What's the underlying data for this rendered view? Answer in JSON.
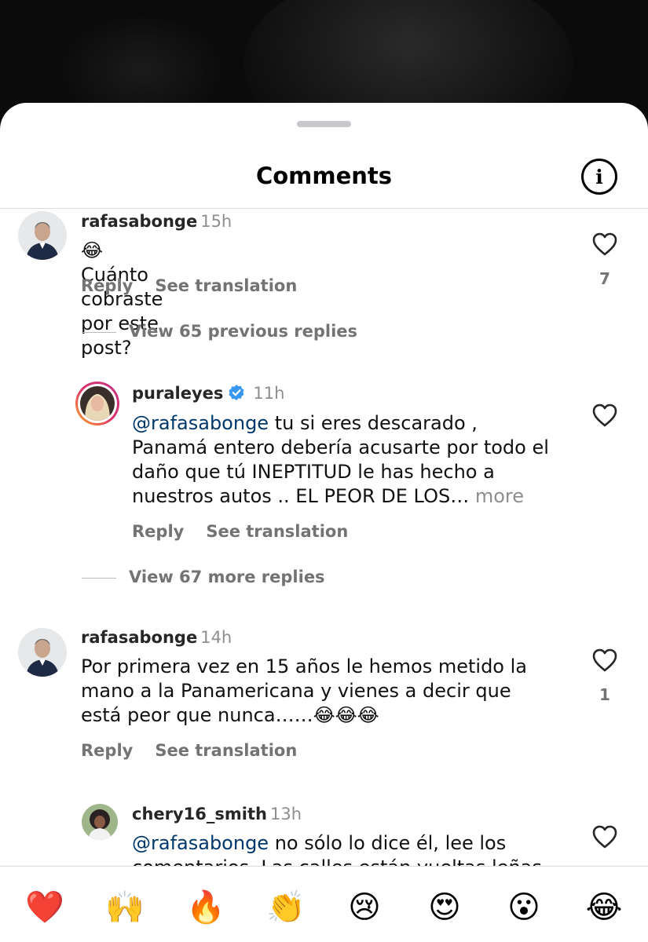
{
  "sheet": {
    "title": "Comments",
    "info_icon": "info-icon"
  },
  "comments": [
    {
      "username": "rafasabonge",
      "time": "15h",
      "emoji": "😂",
      "text": "Cuánto cobraste por este post?",
      "reply_label": "Reply",
      "translate_label": "See translation",
      "likes": "7",
      "view_replies": "View 65 previous replies"
    },
    {
      "username": "puraleyes",
      "verified": true,
      "time": "11h",
      "mention": "@rafasabonge",
      "text_lines": [
        " tu si eres descarado ,",
        "Panamá entero debería acusarte por todo el",
        "daño que tú INEPTITUD  le has hecho a",
        "nuestros autos .. EL PEOR DE LOS…"
      ],
      "more_label": "more",
      "reply_label": "Reply",
      "translate_label": "See translation",
      "view_replies": "View 67 more replies"
    },
    {
      "username": "rafasabonge",
      "time": "14h",
      "text_lines": [
        "Por primera vez en 15 años le hemos metido la",
        "mano a la Panamericana y vienes a decir que",
        "está peor que nunca……😂😂😂"
      ],
      "reply_label": "Reply",
      "translate_label": "See translation",
      "likes": "1"
    },
    {
      "username": "chery16_smith",
      "time": "13h",
      "mention": "@rafasabonge",
      "text_lines": [
        " no sólo lo dice él, lee los",
        "comentarios. Las calles están vueltas leñas"
      ]
    }
  ],
  "reactions": [
    "❤️",
    "🙌",
    "🔥",
    "👏",
    "😢",
    "😍",
    "😮",
    "😂"
  ],
  "colors": {
    "mention": "#00376b",
    "secondary_text": "#737373",
    "verified": "#3897f0"
  }
}
